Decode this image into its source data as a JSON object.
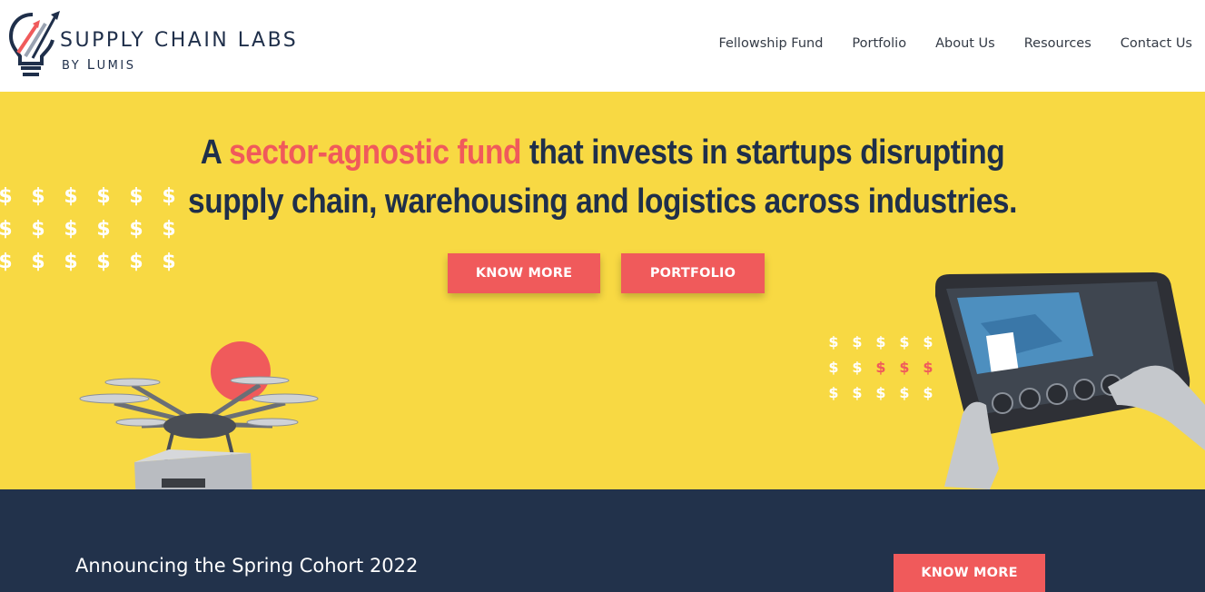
{
  "brand": {
    "title": "SUPPLY CHAIN LABS",
    "subtitle_prefix": "BY ",
    "subtitle_name_initial": "L",
    "subtitle_name_rest": "UMIS",
    "colors": {
      "navy": "#1f2f4a",
      "accent": "#f05a5b",
      "yellow": "#f8d943",
      "band": "#22324b"
    }
  },
  "nav": {
    "items": [
      {
        "label": "Fellowship Fund"
      },
      {
        "label": "Portfolio"
      },
      {
        "label": "About Us"
      },
      {
        "label": "Resources"
      },
      {
        "label": "Contact Us"
      }
    ]
  },
  "hero": {
    "headline_a": "A ",
    "headline_accent": "sector-agnostic fund",
    "headline_rest_1": " that invests in startups disrupting",
    "headline_rest_2": "supply chain, warehousing and logistics across industries.",
    "know_more_label": "KNOW MORE",
    "portfolio_label": "PORTFOLIO",
    "dollar_symbol": "$",
    "illustrations": [
      "delivery-drone",
      "tablet-dashboard"
    ]
  },
  "band": {
    "announcement": "Announcing the Spring Cohort 2022",
    "know_more_label": "KNOW MORE"
  }
}
